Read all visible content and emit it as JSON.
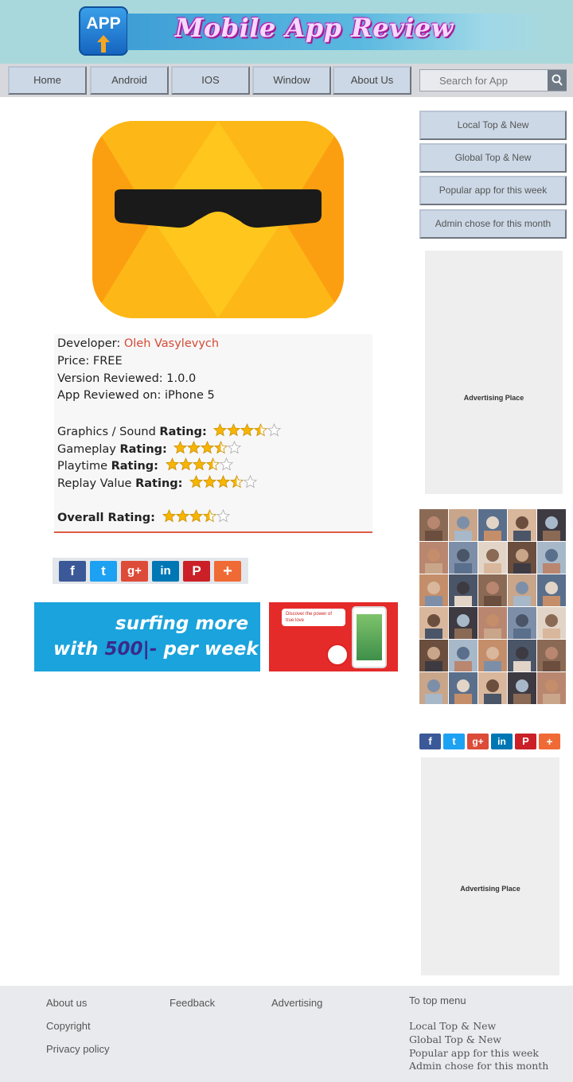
{
  "header": {
    "logo_text": "APP",
    "site_title": "Mobile App Review"
  },
  "nav": {
    "items": [
      "Home",
      "Android",
      "IOS",
      "Window",
      "About  Us"
    ],
    "search_placeholder": "Search for App"
  },
  "sidebar": {
    "menu": [
      "Local Top & New",
      "Global Top & New",
      "Popular app for this week",
      "Admin chose for this month"
    ],
    "ad_label_1": "Advertising Place",
    "ad_label_2": "Advertising Place"
  },
  "app": {
    "developer_label": "Developer:",
    "developer_name": "Oleh Vasylevych",
    "price": "Price: FREE",
    "version": "Version Reviewed: 1.0.0",
    "reviewed_on": "App Reviewed on: iPhone 5",
    "ratings": [
      {
        "label_plain": "Graphics / Sound ",
        "label_bold": "Rating:",
        "stars": 3.5
      },
      {
        "label_plain": "Gameplay ",
        "label_bold": "Rating:",
        "stars": 3.5
      },
      {
        "label_plain": "Playtime ",
        "label_bold": "Rating:",
        "stars": 3.5
      },
      {
        "label_plain": "Replay Value ",
        "label_bold": "Rating:",
        "stars": 3.5
      }
    ],
    "overall_label": "Overall Rating:",
    "overall_stars": 3.5
  },
  "share": {
    "icons": [
      "facebook-icon",
      "twitter-icon",
      "google-plus-icon",
      "linkedin-icon",
      "pinterest-icon",
      "more-icon"
    ],
    "glyphs": [
      "f",
      "t",
      "g+",
      "in",
      "P",
      "+"
    ],
    "colors": [
      "#3b5998",
      "#1da1f2",
      "#dd4b39",
      "#0077b5",
      "#cb2027",
      "#f06a35"
    ]
  },
  "promo": {
    "line1": "surfing more",
    "line2_pre": "with ",
    "line2_num": "500|-",
    "line2_post": " per week",
    "ad_caption": "Discover the power of true love"
  },
  "footer": {
    "col1": [
      "About us",
      "Copyright",
      "Privacy policy"
    ],
    "col2": [
      "Feedback"
    ],
    "col3": [
      "Advertising"
    ],
    "to_top": "To top menu",
    "col4": [
      "Local Top & New",
      "Global Top & New",
      "Popular app for this week",
      "Admin chose for this month"
    ]
  },
  "colors": {
    "header_bg": "#a8d8dc",
    "nav_button": "#ccd8e6",
    "accent_red": "#d44a36",
    "footer_bg": "#e9eaee"
  }
}
